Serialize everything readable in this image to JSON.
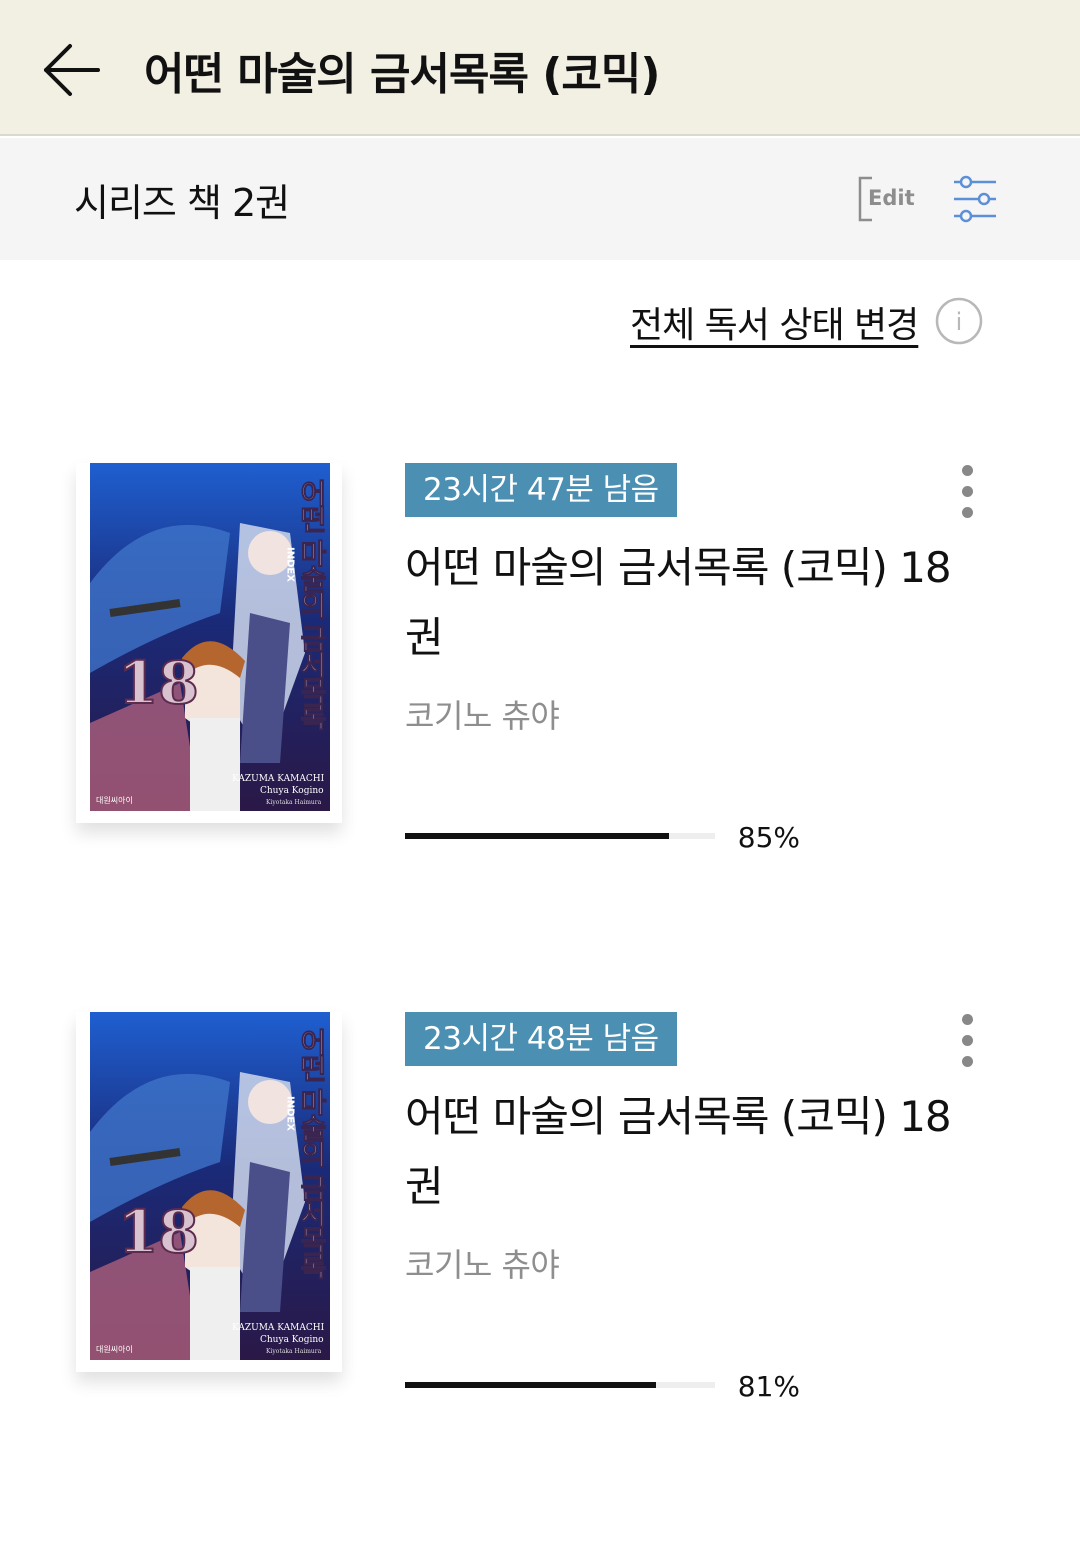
{
  "header": {
    "title": "어떤 마술의 금서목록 (코믹)",
    "back_icon": "arrow-left-icon"
  },
  "subheader": {
    "series_count": "시리즈 책 2권",
    "edit_label": "Edit",
    "filter_icon": "filter-sliders-icon",
    "filter_color": "#5b8fd8"
  },
  "actions": {
    "change_all_status_label": "전체 독서 상태 변경",
    "info_icon": "info-icon",
    "info_label": "i"
  },
  "books": [
    {
      "time_left": "23시간 47분 남음",
      "title": "어떤 마술의 금서목록 (코믹) 18권",
      "author": "코기노 츄야",
      "progress": 0.85,
      "progress_label": "85%",
      "cover": {
        "title_ko": "어떤 마술의 금서목록",
        "index_label": "INDEX",
        "volume": "18",
        "writer": "KAZUMA KAMACHI",
        "artist": "Chuya Kogino",
        "character": "Kiyotaka Haimura",
        "publisher": "대원씨아이"
      }
    },
    {
      "time_left": "23시간 48분 남음",
      "title": "어떤 마술의 금서목록 (코믹) 18권",
      "author": "코기노 츄야",
      "progress": 0.81,
      "progress_label": "81%",
      "cover": {
        "title_ko": "어떤 마술의 금서목록",
        "index_label": "INDEX",
        "volume": "18",
        "writer": "KAZUMA KAMACHI",
        "artist": "Chuya Kogino",
        "character": "Kiyotaka Haimura",
        "publisher": "대원씨아이"
      }
    }
  ],
  "colors": {
    "header_bg": "#f2efe3",
    "subheader_bg": "#f5f5f5",
    "badge_bg": "#4b8fb3",
    "progress_fill": "#111111",
    "author_text": "#8e8e8e"
  }
}
